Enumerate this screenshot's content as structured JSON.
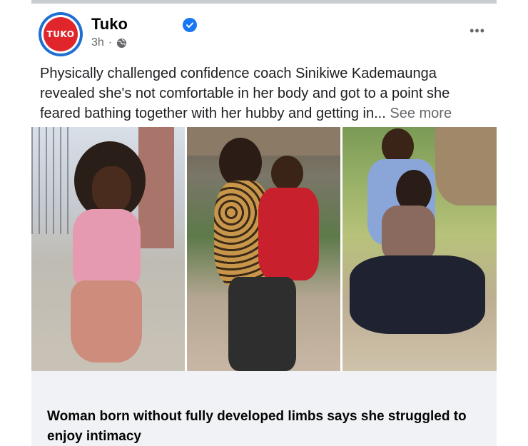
{
  "post": {
    "page_name": "Tuko",
    "time": "3h",
    "separator": "·",
    "logo_text": "TUKO",
    "text": "Physically challenged confidence coach Sinikiwe Kademaunga revealed she's not comfortable in her body and got to a point she feared bathing together with her hubby and getting in...",
    "see_more": "See more",
    "more_icon": "•••"
  },
  "link": {
    "title": "Woman born without fully developed limbs says she struggled to enjoy intimacy"
  },
  "icons": {
    "verified": "verified-badge-icon",
    "audience": "globe-icon",
    "menu": "more-options-icon"
  },
  "colors": {
    "verified": "#1877f2",
    "logo_red": "#e0262b",
    "logo_ring": "#1f6fd1",
    "meta_gray": "#65676b"
  }
}
